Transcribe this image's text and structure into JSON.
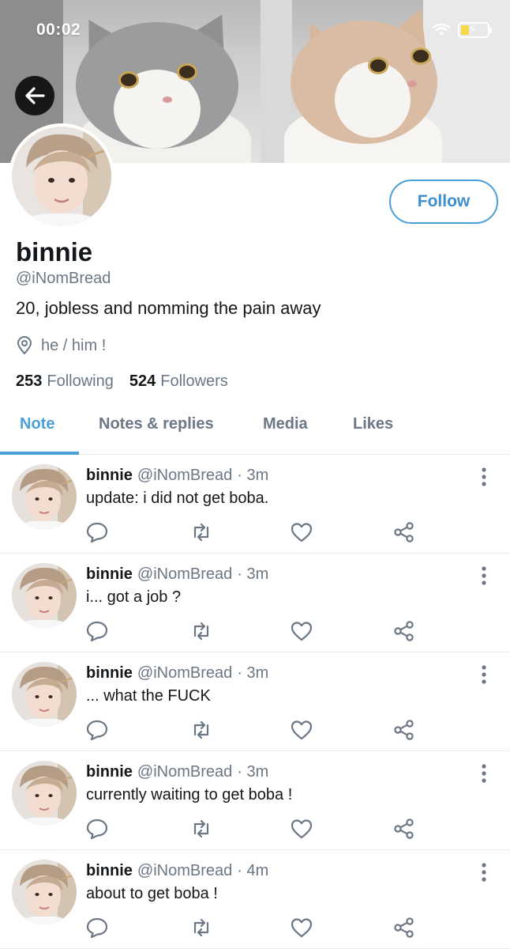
{
  "status_bar": {
    "time": "00:02",
    "wifi_icon": "wifi-icon",
    "battery_icon": "battery-charging-icon"
  },
  "colors": {
    "accent": "#4a9fd8",
    "secondary_text": "#6b7784",
    "primary_text": "#14171a",
    "divider": "#e6ecf0"
  },
  "header": {
    "back_icon": "arrow-left-icon",
    "banner_image": "two-cats-photo"
  },
  "profile": {
    "avatar": "profile-avatar-photo",
    "follow_label": "Follow",
    "display_name": "binnie",
    "handle": "@iNomBread",
    "bio": "20, jobless and nomming the pain away",
    "location_icon": "location-pin-icon",
    "location": "he / him !",
    "following_count": "253",
    "following_label": "Following",
    "followers_count": "524",
    "followers_label": "Followers"
  },
  "tabs": [
    {
      "label": "Note",
      "active": true
    },
    {
      "label": "Notes & replies",
      "active": false
    },
    {
      "label": "Media",
      "active": false
    },
    {
      "label": "Likes",
      "active": false
    }
  ],
  "posts": [
    {
      "name": "binnie",
      "handle": "@iNomBread",
      "time": "· 3m",
      "text": "update: i did not get boba."
    },
    {
      "name": "binnie",
      "handle": "@iNomBread",
      "time": "· 3m",
      "text": "i... got a job ?"
    },
    {
      "name": "binnie",
      "handle": "@iNomBread",
      "time": "· 3m",
      "text": "... what the FUCK"
    },
    {
      "name": "binnie",
      "handle": "@iNomBread",
      "time": "· 3m",
      "text": "currently waiting to get boba !"
    },
    {
      "name": "binnie",
      "handle": "@iNomBread",
      "time": "· 4m",
      "text": "about to get boba !"
    }
  ],
  "post_actions": [
    "reply-icon",
    "renote-icon",
    "like-icon",
    "share-icon"
  ]
}
